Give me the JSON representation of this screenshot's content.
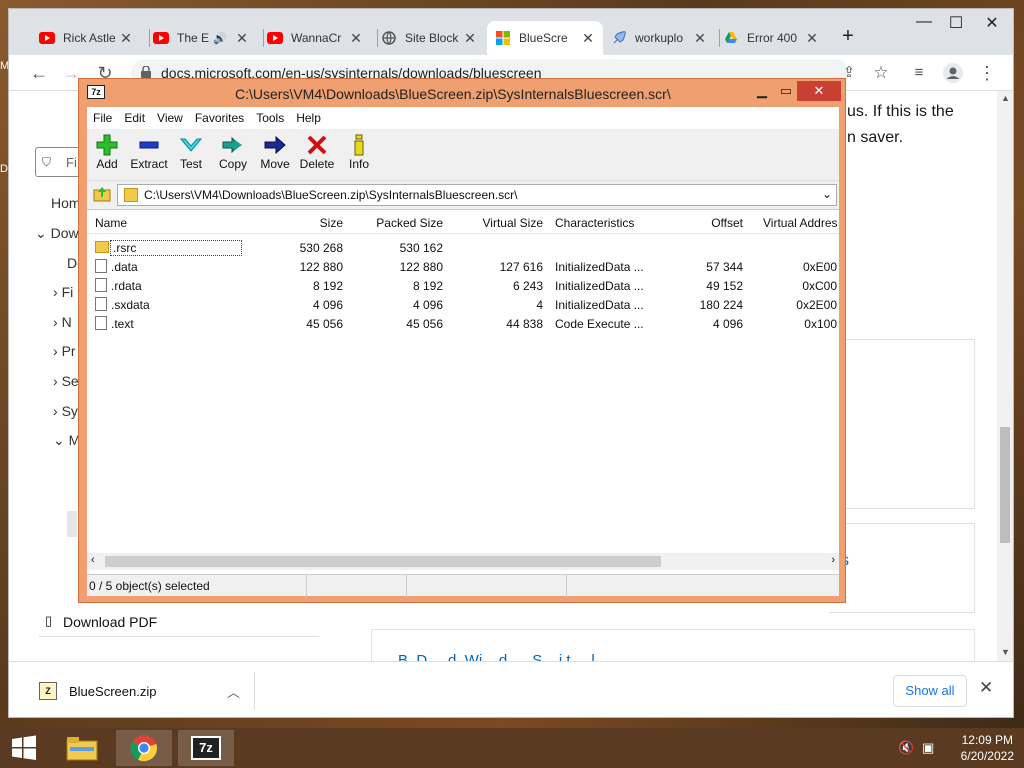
{
  "chrome": {
    "tabs": [
      {
        "title": "Rick Astle",
        "icon": "youtube-icon"
      },
      {
        "title": "The E",
        "icon": "youtube-icon"
      },
      {
        "title": "WannaCr",
        "icon": "youtube-icon"
      },
      {
        "title": "Site Block",
        "icon": "globe-icon"
      },
      {
        "title": "BlueScre",
        "icon": "microsoft-icon"
      },
      {
        "title": "workuplo",
        "icon": "rocket-icon"
      },
      {
        "title": "Error 400",
        "icon": "drive-icon"
      }
    ],
    "new_tab": "+",
    "url": "docs.microsoft.com/en-us/sysinternals/downloads/bluescreen",
    "page": {
      "body_line1": "us. If this is the",
      "body_line2": "n saver.",
      "filter_placeholder": "Fi",
      "nav": [
        "Hom",
        "Dow",
        "Do",
        "Fi",
        "N",
        "Pr",
        "Se",
        "Sy",
        "M"
      ],
      "download_pdf": "Download PDF",
      "link_s": "s",
      "bottom_link": "B. D.... d. Wi... d..... S....i.t.....l"
    },
    "downloads": {
      "filename": "BlueScreen.zip",
      "show_all": "Show all"
    }
  },
  "sevenzip": {
    "title": "C:\\Users\\VM4\\Downloads\\BlueScreen.zip\\SysInternalsBluescreen.scr\\",
    "app_icon": "7z",
    "menu": [
      "File",
      "Edit",
      "View",
      "Favorites",
      "Tools",
      "Help"
    ],
    "tools": [
      "Add",
      "Extract",
      "Test",
      "Copy",
      "Move",
      "Delete",
      "Info"
    ],
    "address": "C:\\Users\\VM4\\Downloads\\BlueScreen.zip\\SysInternalsBluescreen.scr\\",
    "columns": [
      "Name",
      "Size",
      "Packed Size",
      "Virtual Size",
      "Characteristics",
      "Offset",
      "Virtual Addres"
    ],
    "rows": [
      {
        "name": ".rsrc",
        "type": "folder",
        "size": "530 268",
        "packed": "530 162",
        "vsize": "",
        "chars": "",
        "offset": "",
        "vaddr": ""
      },
      {
        "name": ".data",
        "type": "file",
        "size": "122 880",
        "packed": "122 880",
        "vsize": "127 616",
        "chars": "InitializedData ...",
        "offset": "57 344",
        "vaddr": "0xE00"
      },
      {
        "name": ".rdata",
        "type": "file",
        "size": "8 192",
        "packed": "8 192",
        "vsize": "6 243",
        "chars": "InitializedData ...",
        "offset": "49 152",
        "vaddr": "0xC00"
      },
      {
        "name": ".sxdata",
        "type": "file",
        "size": "4 096",
        "packed": "4 096",
        "vsize": "4",
        "chars": "InitializedData ...",
        "offset": "180 224",
        "vaddr": "0x2E00"
      },
      {
        "name": ".text",
        "type": "file",
        "size": "45 056",
        "packed": "45 056",
        "vsize": "44 838",
        "chars": "Code Execute ...",
        "offset": "4 096",
        "vaddr": "0x100"
      }
    ],
    "status": "0 / 5 object(s) selected"
  },
  "taskbar": {
    "time": "12:09 PM",
    "date": "6/20/2022",
    "sevenzip_label": "7z"
  },
  "desktop": {
    "edge_m": "M",
    "edge_d": "D"
  },
  "colors": {
    "sevenzip_frame": "#f0a070",
    "close_red": "#c74032",
    "chrome_tabstrip": "#dee1e6",
    "link_blue": "#1a73e8"
  }
}
